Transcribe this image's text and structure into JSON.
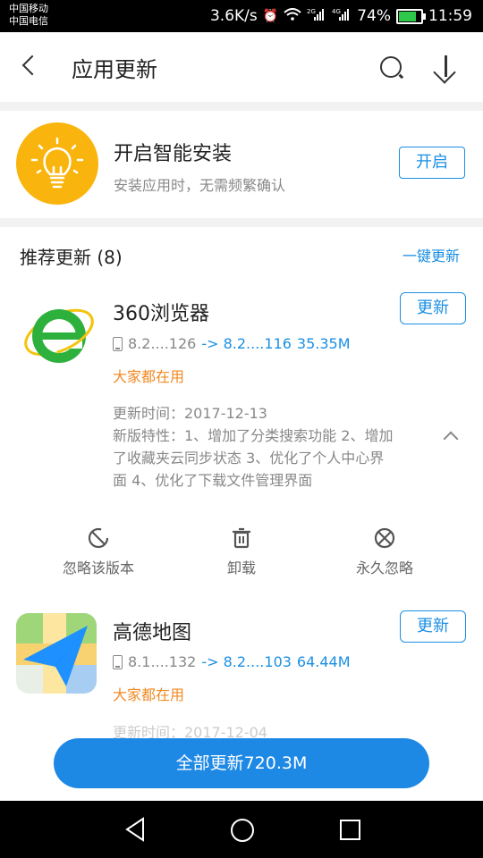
{
  "status_bar": {
    "carrier1": "中国移动",
    "carrier2": "中国电信",
    "speed": "3.6K/s",
    "signal_label_1": "2G",
    "signal_label_2": "4G",
    "battery": "74%",
    "battery_level": 0.74,
    "time": "11:59"
  },
  "toolbar": {
    "title": "应用更新",
    "search_icon": "search-icon",
    "download_icon": "download-icon"
  },
  "install_card": {
    "title": "开启智能安装",
    "subtitle": "安装应用时，无需频繁确认",
    "button": "开启"
  },
  "section": {
    "title": "推荐更新 (8)",
    "action": "一键更新"
  },
  "apps": [
    {
      "name": "360浏览器",
      "button": "更新",
      "old_version": "8.2....126",
      "new_version": "-> 8.2....116",
      "size": "35.35M",
      "tag": "大家都在用",
      "update_time": "更新时间：2017-12-13",
      "features_line1": "新版特性：1、增加了分类搜索功能 2、增加",
      "features_line2": "了收藏夹云同步状态 3、优化了个人中心界",
      "features_line3": "面 4、优化了下载文件管理界面",
      "actions": [
        "忽略该版本",
        "卸载",
        "永久忽略"
      ]
    },
    {
      "name": "高德地图",
      "button": "更新",
      "old_version": "8.1....132",
      "new_version": "-> 8.2....103",
      "size": "64.44M",
      "tag": "大家都在用",
      "update_time_partial": "更新时间：2017-12-04"
    }
  ],
  "update_all": "全部更新720.3M",
  "colors": {
    "accent": "#1a8fe3",
    "update_all_bg": "#1e88e5",
    "tag": "#f08a24",
    "bulb_bg": "#f9b50e",
    "browser_green": "#2db13c",
    "map_blue": "#1e90ff"
  }
}
